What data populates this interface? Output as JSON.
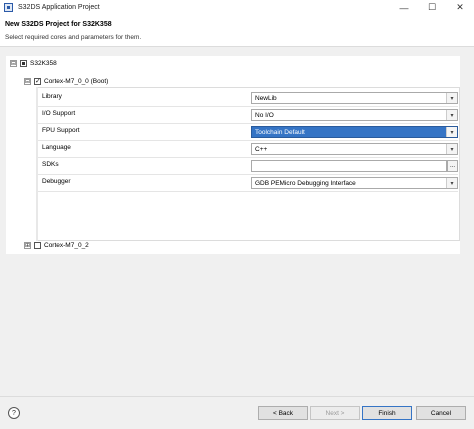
{
  "window": {
    "title": "S32DS Application Project",
    "min_glyph": "—",
    "max_glyph": "☐",
    "close_glyph": "✕"
  },
  "header": {
    "title": "New S32DS Project for S32K358",
    "description": "Select required cores and parameters for them."
  },
  "tree": {
    "root_label": "S32K358",
    "root_expander": "⊟",
    "cores": [
      {
        "label": "Cortex-M7_0_0 (Boot)",
        "expander": "⊟",
        "checked": true,
        "properties": [
          {
            "label": "Library",
            "value": "NewLib",
            "type": "combo"
          },
          {
            "label": "I/O Support",
            "value": "No I/O",
            "type": "combo"
          },
          {
            "label": "FPU Support",
            "value": "Toolchain Default",
            "type": "combo",
            "selected": true
          },
          {
            "label": "Language",
            "value": "C++",
            "type": "combo"
          },
          {
            "label": "SDKs",
            "value": "",
            "type": "browse",
            "browse_label": "..."
          },
          {
            "label": "Debugger",
            "value": "GDB PEMicro Debugging Interface",
            "type": "combo"
          }
        ]
      },
      {
        "label": "Cortex-M7_0_2",
        "expander": "⊞",
        "checked": false
      }
    ]
  },
  "footer": {
    "help_glyph": "?",
    "back_label": "< Back",
    "next_label": "Next >",
    "finish_label": "Finish",
    "cancel_label": "Cancel"
  },
  "colors": {
    "selection": "#3574c5",
    "background": "#f0f0f0"
  }
}
